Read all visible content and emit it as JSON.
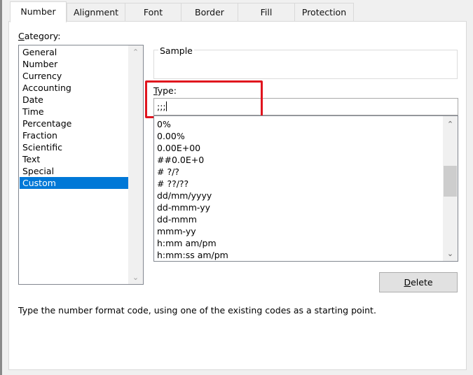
{
  "tabs": [
    {
      "label": "Number",
      "active": true
    },
    {
      "label": "Alignment",
      "active": false
    },
    {
      "label": "Font",
      "active": false
    },
    {
      "label": "Border",
      "active": false
    },
    {
      "label": "Fill",
      "active": false
    },
    {
      "label": "Protection",
      "active": false
    }
  ],
  "category": {
    "label_prefix": "C",
    "label_rest": "ategory:",
    "items": [
      "General",
      "Number",
      "Currency",
      "Accounting",
      "Date",
      "Time",
      "Percentage",
      "Fraction",
      "Scientific",
      "Text",
      "Special",
      "Custom"
    ],
    "selected": "Custom"
  },
  "sample": {
    "label": "Sample",
    "value": ""
  },
  "type": {
    "label_prefix": "T",
    "label_rest": "ype:",
    "value": ";;;"
  },
  "format_codes": [
    "0%",
    "0.00%",
    "0.00E+00",
    "##0.0E+0",
    "# ?/?",
    "# ??/??",
    "dd/mm/yyyy",
    "dd-mmm-yy",
    "dd-mmm",
    "mmm-yy",
    "h:mm am/pm",
    "h:mm:ss am/pm"
  ],
  "delete_button": {
    "prefix": "D",
    "rest": "elete"
  },
  "hint": "Type the number format code, using one of the existing codes as a starting point.",
  "icons": {
    "scroll_up": "chevron-up-icon",
    "scroll_down": "chevron-down-icon"
  },
  "colors": {
    "accent": "#0078d7",
    "highlight": "#e0141e"
  }
}
